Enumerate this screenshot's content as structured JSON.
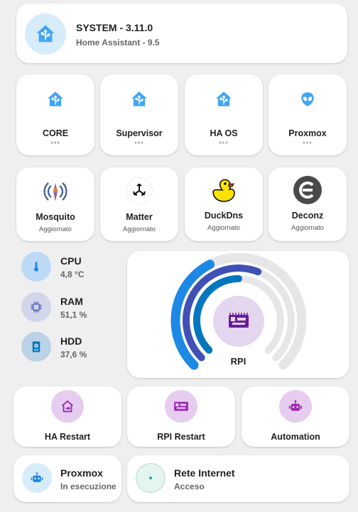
{
  "system": {
    "title": "SYSTEM - 3.11.0",
    "subtitle": "Home Assistant - 9.5"
  },
  "components": [
    {
      "label": "CORE",
      "status": "***",
      "icon": "home-assistant-icon"
    },
    {
      "label": "Supervisor",
      "status": "***",
      "icon": "home-assistant-icon"
    },
    {
      "label": "HA OS",
      "status": "***",
      "icon": "home-assistant-icon"
    },
    {
      "label": "Proxmox",
      "status": "***",
      "icon": "alien-icon"
    }
  ],
  "addons": [
    {
      "label": "Mosquito",
      "status": "Aggiornato",
      "icon": "mosquitto-icon"
    },
    {
      "label": "Matter",
      "status": "Aggiornato",
      "icon": "matter-icon"
    },
    {
      "label": "DuckDns",
      "status": "Aggiornato",
      "icon": "duck-icon"
    },
    {
      "label": "Deconz",
      "status": "Aggiornato",
      "icon": "deconz-icon"
    }
  ],
  "resources": [
    {
      "label": "CPU",
      "value": "4,8 °C",
      "icon": "thermometer-icon"
    },
    {
      "label": "RAM",
      "value": "51,1 %",
      "icon": "chip-icon"
    },
    {
      "label": "HDD",
      "value": "37,6 %",
      "icon": "harddisk-icon"
    }
  ],
  "gauge": {
    "label": "RPI",
    "icon": "raspberry-board-icon",
    "levels": [
      0.4,
      0.58,
      0.5
    ],
    "colors": [
      "#1e88e5",
      "#3f51b5",
      "#0277bd"
    ]
  },
  "actions": [
    {
      "label": "HA Restart",
      "icon": "restart-icon"
    },
    {
      "label": "RPI Restart",
      "icon": "board-restart-icon"
    },
    {
      "label": "Automation",
      "icon": "robot-icon"
    }
  ],
  "status_cards": [
    {
      "title": "Proxmox",
      "subtitle": "In esecuzione",
      "icon": "robot-icon"
    },
    {
      "title": "Rete Internet",
      "subtitle": "Acceso",
      "icon": "network-dot-icon"
    }
  ],
  "colors": {
    "accent_blue": "#42a5f5",
    "purple": "#9c27b0",
    "purple_bg": "#e1c7ee"
  }
}
